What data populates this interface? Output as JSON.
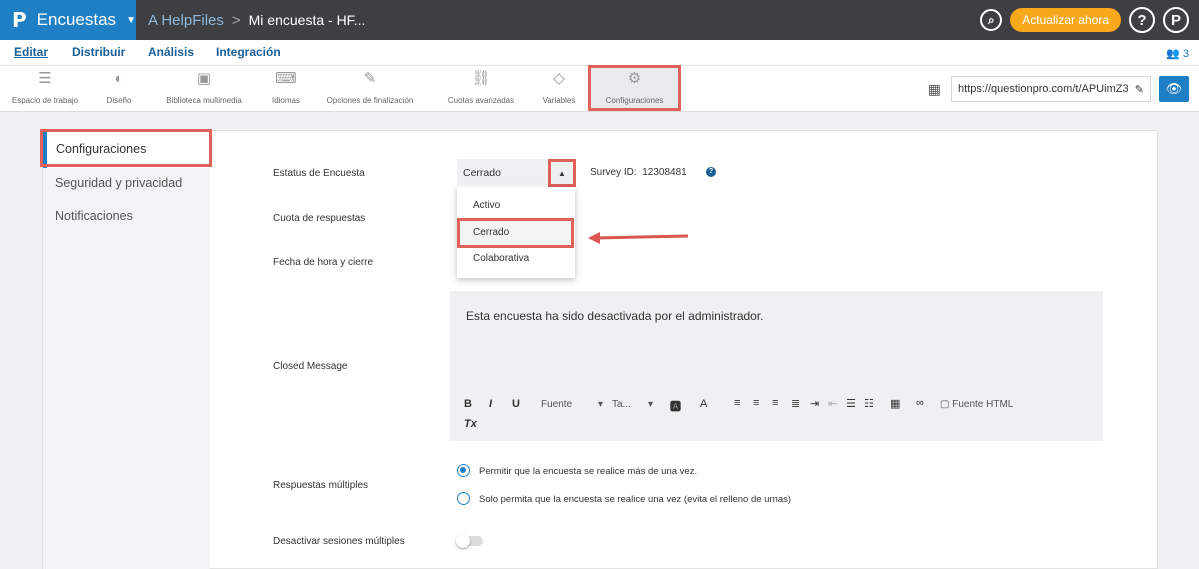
{
  "topbar": {
    "logo": "P",
    "product": "Encuestas",
    "crumb_parent": "A HelpFiles",
    "crumb_sep": ">",
    "crumb_current": "Mi encuesta - HF...",
    "search_icon_glyph": "Q",
    "upgrade_label": "Actualizar ahora",
    "help_glyph": "?",
    "profile_glyph": "P"
  },
  "mainnav": {
    "tabs": [
      "Editar",
      "Distribuir",
      "Análisis",
      "Integración"
    ],
    "users_count": "3"
  },
  "toolbar": {
    "tools": [
      {
        "label": "Espacio de trabajo",
        "icon": "workspace-icon"
      },
      {
        "label": "Diseño",
        "icon": "palette-icon"
      },
      {
        "label": "Biblioteca multimedia",
        "icon": "image-icon"
      },
      {
        "label": "Idiomas",
        "icon": "translate-icon"
      },
      {
        "label": "Opciones de finalización",
        "icon": "wand-icon"
      },
      {
        "label": "Cuotas avanzadas",
        "icon": "link-icon"
      },
      {
        "label": "Variables",
        "icon": "tag-icon"
      },
      {
        "label": "Configuraciones",
        "icon": "gear-icon"
      }
    ],
    "url": "https://questionpro.com/t/APUimZ3"
  },
  "sidebar": {
    "items": [
      "Configuraciones",
      "Seguridad y privacidad",
      "Notificaciones"
    ]
  },
  "settings": {
    "status_label": "Estatus de Encuesta",
    "status_value": "Cerrado",
    "survey_id_label": "Survey ID:",
    "survey_id": "12308481",
    "quota_label": "Cuota de respuestas",
    "close_date_label": "Fecha de hora y cierre",
    "dropdown_options": [
      "Activo",
      "Cerrado",
      "Colaborativa"
    ],
    "closed_message_label": "Closed Message",
    "closed_message": "Esta encuesta ha sido desactivada por el administrador.",
    "editor": {
      "bold": "B",
      "italic": "I",
      "underline": "U",
      "font": "Fuente",
      "size": "Ta...",
      "html": "Fuente HTML",
      "clear": "Tx"
    },
    "multiple_label": "Respuestas múltiples",
    "multiple_opt1": "Permitir que la encuesta se realice más de una vez.",
    "multiple_opt2": "Solo permita que la encuesta se realice una vez (evita el relleno de urnas)",
    "multiple_selected": 0,
    "sessions_label": "Desactivar sesiones múltiples",
    "sessions_enabled": false
  },
  "colors": {
    "brand": "#1f7fc4",
    "topbar": "#3d3f42",
    "highlight": "#e0605a",
    "upgrade": "#f7a81b"
  }
}
